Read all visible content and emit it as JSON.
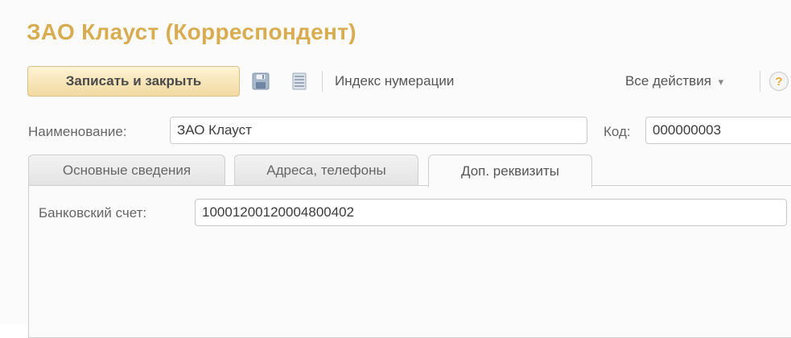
{
  "window": {
    "title": "ЗАО Клауст (Корреспондент)"
  },
  "toolbar": {
    "save_close_label": "Записать и закрыть",
    "save_icon": "floppy-disk-icon",
    "list_icon": "document-list-icon",
    "numbering_index_label": "Индекс нумерации",
    "all_actions_label": "Все действия",
    "all_actions_arrow": "▾",
    "help_label": "?"
  },
  "form": {
    "name_label": "Наименование:",
    "name_value": "ЗАО Клауст",
    "code_label": "Код:",
    "code_value": "000000003"
  },
  "tabs": [
    {
      "label": "Основные сведения",
      "active": false
    },
    {
      "label": "Адреса, телефоны",
      "active": false
    },
    {
      "label": "Доп. реквизиты",
      "active": true
    }
  ],
  "tab_content": {
    "bank_account_label": "Банковский счет:",
    "bank_account_value": "10001200120004800402"
  },
  "colors": {
    "title": "#d8ad52",
    "button_fill": "#f1d9a0",
    "help_mark": "#e2a93a"
  }
}
